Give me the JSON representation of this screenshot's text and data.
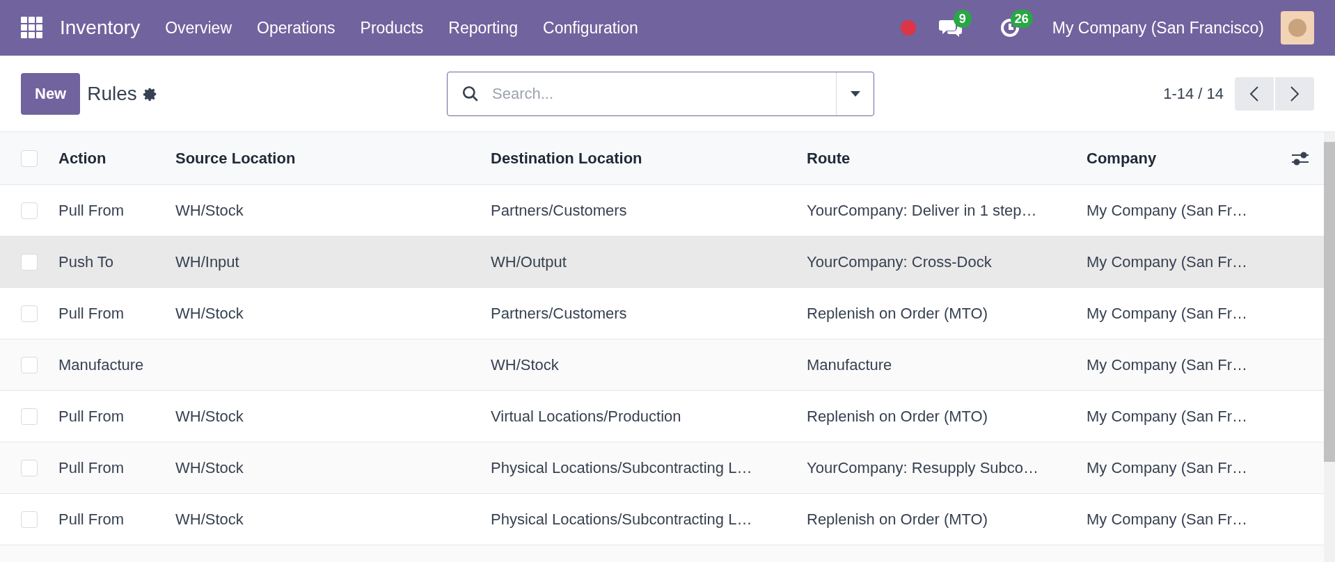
{
  "navbar": {
    "app_name": "Inventory",
    "menu": [
      "Overview",
      "Operations",
      "Products",
      "Reporting",
      "Configuration"
    ],
    "messages_count": "9",
    "activities_count": "26",
    "company": "My Company (San Francisco)"
  },
  "control_panel": {
    "new_button": "New",
    "title": "Rules",
    "search": {
      "placeholder": "Search..."
    },
    "pager": "1-14 / 14"
  },
  "table": {
    "select_all_checked": false,
    "columns": [
      "Action",
      "Source Location",
      "Destination Location",
      "Route",
      "Company"
    ],
    "rows": [
      {
        "hovered": false,
        "checked": false,
        "cells": [
          "Pull From",
          "WH/Stock",
          "Partners/Customers",
          "YourCompany: Deliver in 1 step…",
          "My Company (San Fr…"
        ]
      },
      {
        "hovered": true,
        "checked": false,
        "cells": [
          "Push To",
          "WH/Input",
          "WH/Output",
          "YourCompany: Cross-Dock",
          "My Company (San Fr…"
        ]
      },
      {
        "hovered": false,
        "checked": false,
        "cells": [
          "Pull From",
          "WH/Stock",
          "Partners/Customers",
          "Replenish on Order (MTO)",
          "My Company (San Fr…"
        ]
      },
      {
        "hovered": false,
        "checked": false,
        "cells": [
          "Manufacture",
          "",
          "WH/Stock",
          "Manufacture",
          "My Company (San Fr…"
        ]
      },
      {
        "hovered": false,
        "checked": false,
        "cells": [
          "Pull From",
          "WH/Stock",
          "Virtual Locations/Production",
          "Replenish on Order (MTO)",
          "My Company (San Fr…"
        ]
      },
      {
        "hovered": false,
        "checked": false,
        "cells": [
          "Pull From",
          "WH/Stock",
          "Physical Locations/Subcontracting L…",
          "YourCompany: Resupply Subco…",
          "My Company (San Fr…"
        ]
      },
      {
        "hovered": false,
        "checked": false,
        "cells": [
          "Pull From",
          "WH/Stock",
          "Physical Locations/Subcontracting L…",
          "Replenish on Order (MTO)",
          "My Company (San Fr…"
        ]
      }
    ]
  }
}
